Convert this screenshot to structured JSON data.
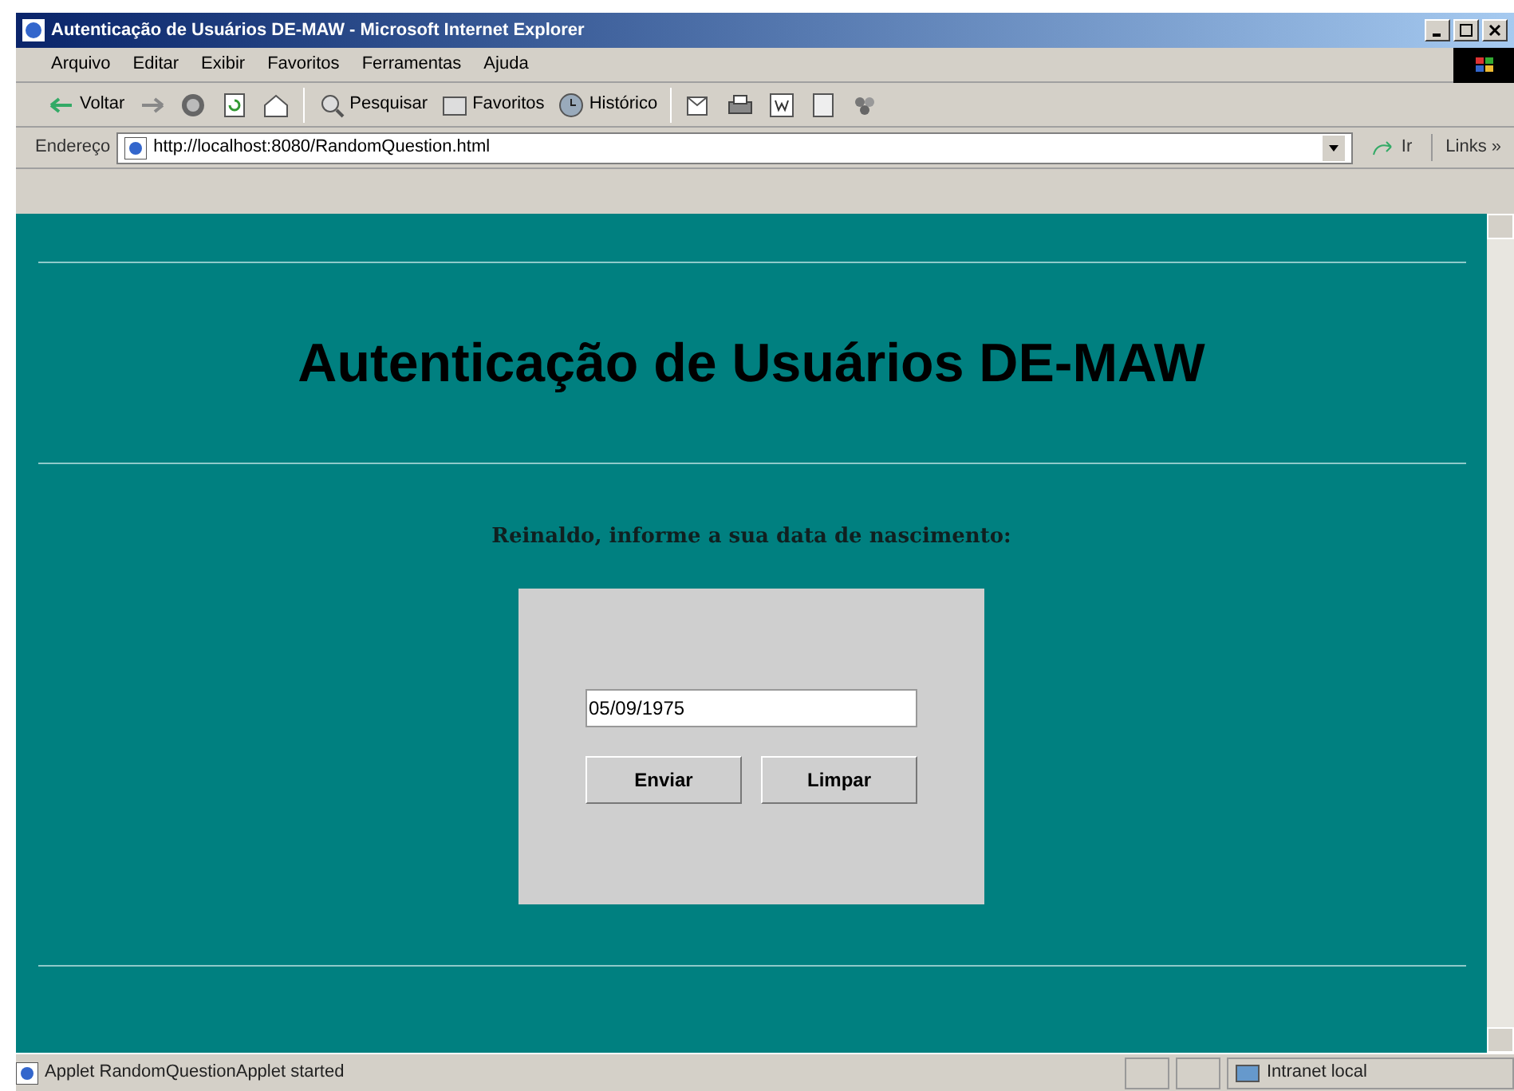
{
  "window": {
    "title": "Autenticação de Usuários DE-MAW - Microsoft Internet Explorer"
  },
  "menu": [
    "Arquivo",
    "Editar",
    "Exibir",
    "Favoritos",
    "Ferramentas",
    "Ajuda"
  ],
  "toolbar": [
    {
      "kind": "back",
      "label": "Voltar"
    },
    {
      "kind": "forward"
    },
    {
      "kind": "stop"
    },
    {
      "kind": "refresh"
    },
    {
      "kind": "home"
    },
    {
      "kind": "sep"
    },
    {
      "kind": "search",
      "label": "Pesquisar"
    },
    {
      "kind": "favorites",
      "label": "Favoritos"
    },
    {
      "kind": "history",
      "label": "Histórico"
    },
    {
      "kind": "sep"
    },
    {
      "kind": "mail"
    },
    {
      "kind": "print"
    },
    {
      "kind": "edit"
    },
    {
      "kind": "discuss"
    },
    {
      "kind": "messenger"
    }
  ],
  "address": {
    "label": "Endereço",
    "value": "http://localhost:8080/RandomQuestion.html",
    "go": "Ir",
    "links": "Links »"
  },
  "page": {
    "heading": "Autenticação de Usuários DE-MAW",
    "prompt": "Reinaldo, informe a sua data de nascimento:",
    "date_value": "05/09/1975",
    "buttons": [
      "Enviar",
      "Limpar"
    ]
  },
  "status_bar": {
    "message": "Applet RandomQuestionApplet started",
    "zone": "Intranet local"
  }
}
